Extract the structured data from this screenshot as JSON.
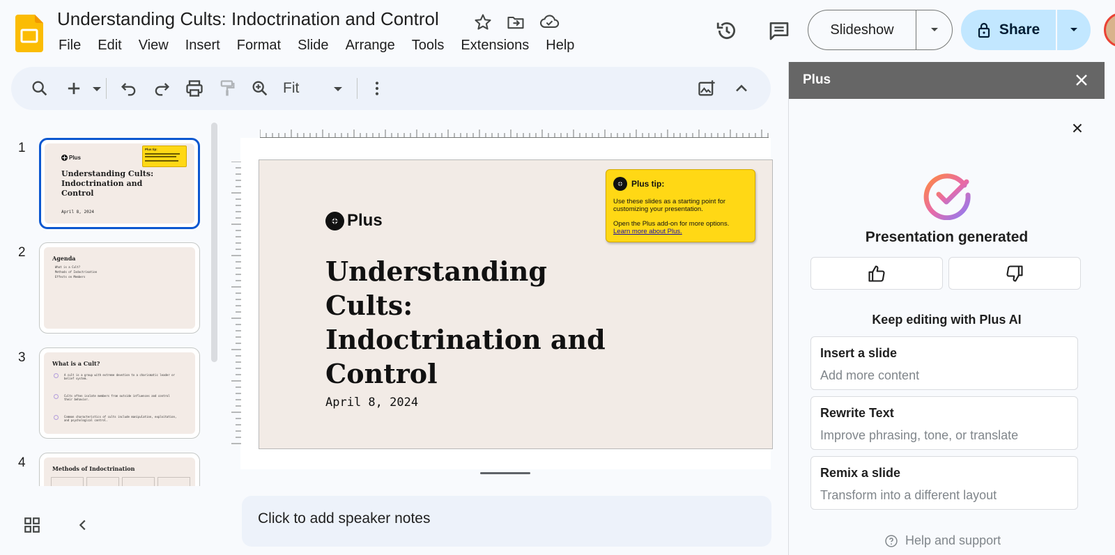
{
  "app": {
    "doc_title": "Understanding Cults: Indoctrination and Control",
    "menu": [
      "File",
      "Edit",
      "View",
      "Insert",
      "Format",
      "Slide",
      "Arrange",
      "Tools",
      "Extensions",
      "Help"
    ],
    "slideshow_label": "Slideshow",
    "share_label": "Share",
    "accent_color": "#0b57d0",
    "share_bg": "#c2e7ff"
  },
  "toolbar": {
    "zoom_value": "Fit",
    "icons": [
      "search-icon",
      "add-icon",
      "undo-icon",
      "redo-icon",
      "print-icon",
      "paint-format-icon",
      "zoom-icon",
      "more-icon",
      "insert-image-icon",
      "collapse-icon"
    ]
  },
  "filmstrip": {
    "slides": [
      {
        "num": "1",
        "logo": "Plus",
        "title": "Understanding Cults: Indoctrination and Control",
        "date": "April 8, 2024",
        "tip": "Plus tip:"
      },
      {
        "num": "2",
        "title": "Agenda",
        "items": [
          "What is a Cult?",
          "Methods of Indoctrination",
          "Effects on Members"
        ]
      },
      {
        "num": "3",
        "title": "What is a Cult?",
        "items": [
          "A cult is a group with extreme devotion to a charismatic leader or belief system.",
          "Cults often isolate members from outside influences and control their behavior.",
          "Common characteristics of cults include manipulation, exploitation, and psychological control."
        ]
      },
      {
        "num": "4",
        "title": "Methods of Indoctrination"
      }
    ]
  },
  "slide": {
    "logo": "Plus",
    "title": "Understanding Cults: Indoctrination and Control",
    "date": "April 8, 2024",
    "tip": {
      "heading": "Plus tip:",
      "body1": "Use these slides as a starting point for customizing your presentation.",
      "body2": "Open the Plus add-on for more options.",
      "link": "Learn more about Plus."
    }
  },
  "notes": {
    "placeholder": "Click to add speaker notes"
  },
  "panel": {
    "title": "Plus",
    "generated": "Presentation generated",
    "keep_editing": "Keep editing with Plus AI",
    "actions": [
      {
        "title": "Insert a slide",
        "subtitle": "Add more content"
      },
      {
        "title": "Rewrite Text",
        "subtitle": "Improve phrasing, tone, or translate"
      },
      {
        "title": "Remix a slide",
        "subtitle": "Transform into a different layout"
      }
    ],
    "help": "Help and support"
  }
}
